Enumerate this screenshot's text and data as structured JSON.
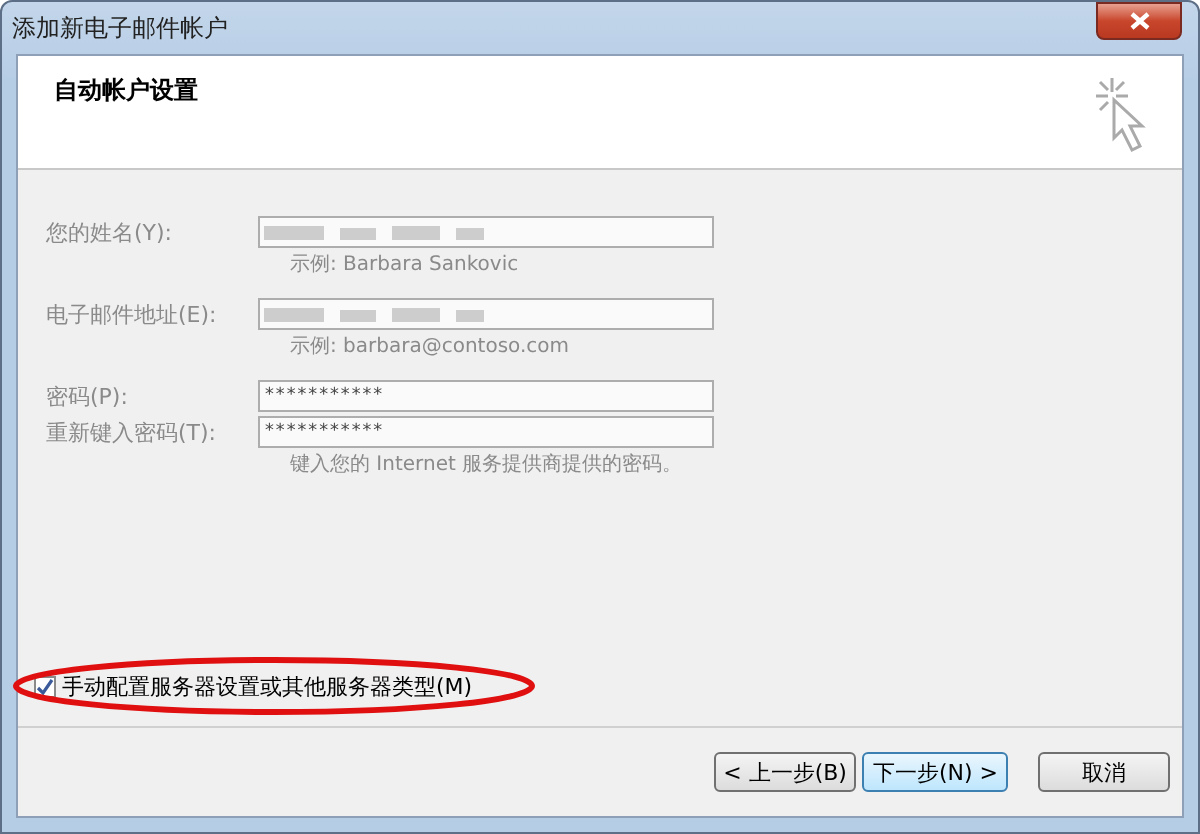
{
  "window": {
    "title": "添加新电子邮件帐户"
  },
  "header": {
    "title": "自动帐户设置"
  },
  "fields": [
    {
      "label": "您的姓名(Y):",
      "kind": "redacted",
      "disabled": true,
      "example": "示例: Barbara Sankovic"
    },
    {
      "label": "电子邮件地址(E):",
      "kind": "redacted",
      "disabled": true,
      "example": "示例: barbara@contoso.com"
    },
    {
      "label": "密码(P):",
      "kind": "password",
      "disabled": true,
      "value": "***********"
    },
    {
      "label": "重新键入密码(T):",
      "kind": "password",
      "disabled": true,
      "value": "***********",
      "example": "键入您的 Internet 服务提供商提供的密码。"
    }
  ],
  "manual_setup": {
    "label": "手动配置服务器设置或其他服务器类型(M)",
    "checked": true,
    "highlighted": true
  },
  "buttons": [
    {
      "label": "< 上一步(B)",
      "default": false
    },
    {
      "label": "下一步(N) >",
      "default": true
    },
    {
      "label": "取消",
      "default": false
    }
  ]
}
